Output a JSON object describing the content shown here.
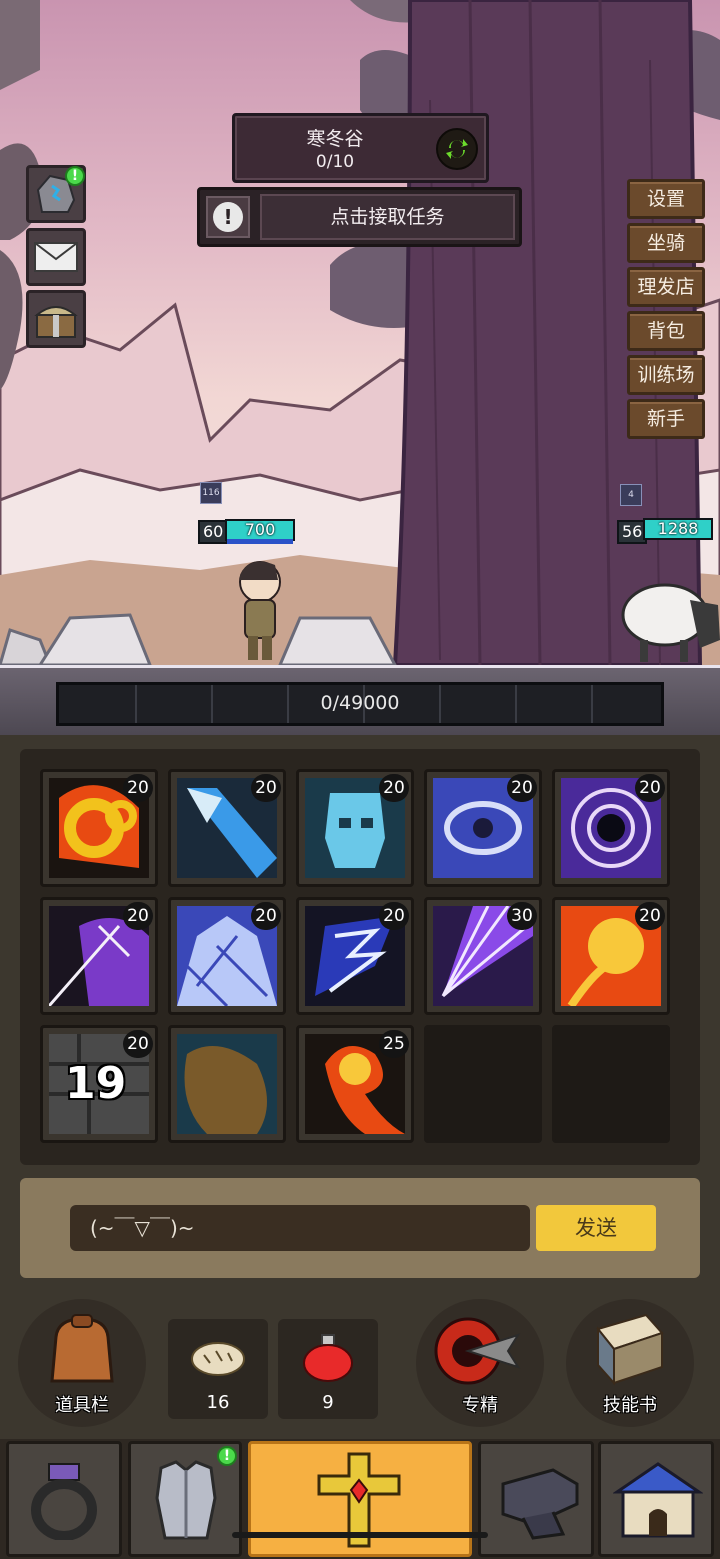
{
  "zone": {
    "name": "寒冬谷",
    "progress": "0/10"
  },
  "quest": {
    "label": "点击接取任务",
    "icon": "exclamation-icon"
  },
  "side_buttons": [
    {
      "name": "rune-stone",
      "icon": "rune-stone-icon",
      "badge": "!"
    },
    {
      "name": "mail",
      "icon": "mail-icon"
    },
    {
      "name": "treasure-chest",
      "icon": "chest-icon"
    }
  ],
  "menu": [
    "设置",
    "坐骑",
    "理发店",
    "背包",
    "训练场",
    "新手"
  ],
  "player": {
    "tag": "116",
    "level": "60",
    "hp": "700",
    "hp_fraction": 1.0
  },
  "enemy": {
    "tag": "4",
    "level": "56",
    "hp": "1288",
    "hp_fraction": 1.0
  },
  "xp": {
    "text": "0/49000",
    "fraction": 0
  },
  "skills": [
    {
      "name": "skill-gold-chain",
      "level": "20"
    },
    {
      "name": "skill-ice-spear",
      "level": "20"
    },
    {
      "name": "skill-frost-skull",
      "level": "20"
    },
    {
      "name": "skill-eye-storm",
      "level": "20"
    },
    {
      "name": "skill-arcane-web",
      "level": "20"
    },
    {
      "name": "skill-shadow-flash",
      "level": "20"
    },
    {
      "name": "skill-ice-shards",
      "level": "20"
    },
    {
      "name": "skill-thunder",
      "level": "20"
    },
    {
      "name": "skill-purple-rays",
      "level": "30"
    },
    {
      "name": "skill-fire-orb",
      "level": "20"
    },
    {
      "name": "skill-stone-wall",
      "level": "20",
      "counter": "19"
    },
    {
      "name": "skill-earth-boulder",
      "level": ""
    },
    {
      "name": "skill-fire-swirl",
      "level": "25"
    },
    {
      "name": "empty",
      "level": ""
    },
    {
      "name": "empty",
      "level": ""
    }
  ],
  "chat": {
    "value": "(~￣▽￣)~",
    "send_label": "发送"
  },
  "actions": {
    "inventory_label": "道具栏",
    "bread_count": "16",
    "potion_count": "9",
    "specialize_label": "专精",
    "skillbook_label": "技能书"
  },
  "nav": [
    {
      "name": "nav-ring",
      "icon": "ring-icon"
    },
    {
      "name": "nav-armor",
      "icon": "armor-icon",
      "badge": "!"
    },
    {
      "name": "nav-relic",
      "icon": "relic-cross-icon",
      "active": true
    },
    {
      "name": "nav-anvil",
      "icon": "anvil-icon"
    },
    {
      "name": "nav-house",
      "icon": "house-icon"
    }
  ],
  "colors": {
    "accent": "#f2c83c",
    "hp": "#2fd0c8",
    "nav_active": "#f6b042"
  }
}
